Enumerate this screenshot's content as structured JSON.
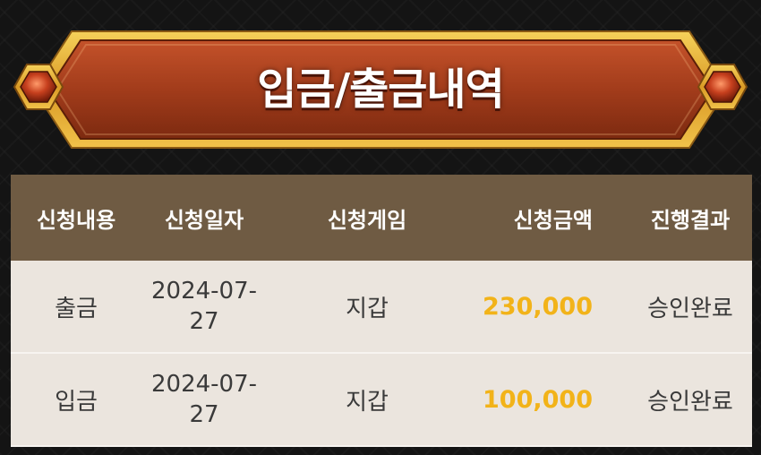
{
  "banner": {
    "title": "입금/출금내역"
  },
  "table": {
    "headers": [
      "신청내용",
      "신청일자",
      "신청게임",
      "신청금액",
      "진행결과"
    ],
    "rows": [
      {
        "type": "출금",
        "date": "2024-07-27",
        "game": "지갑",
        "amount": "230,000",
        "result": "승인완료"
      },
      {
        "type": "입금",
        "date": "2024-07-27",
        "game": "지갑",
        "amount": "100,000",
        "result": "승인완료"
      }
    ]
  },
  "colors": {
    "background": "#141414",
    "banner_fill": "#a8401f",
    "banner_border": "#e8b83a",
    "header_bg": "#6f5b43",
    "row_bg": "#ebe5de",
    "amount": "#f2b319"
  }
}
